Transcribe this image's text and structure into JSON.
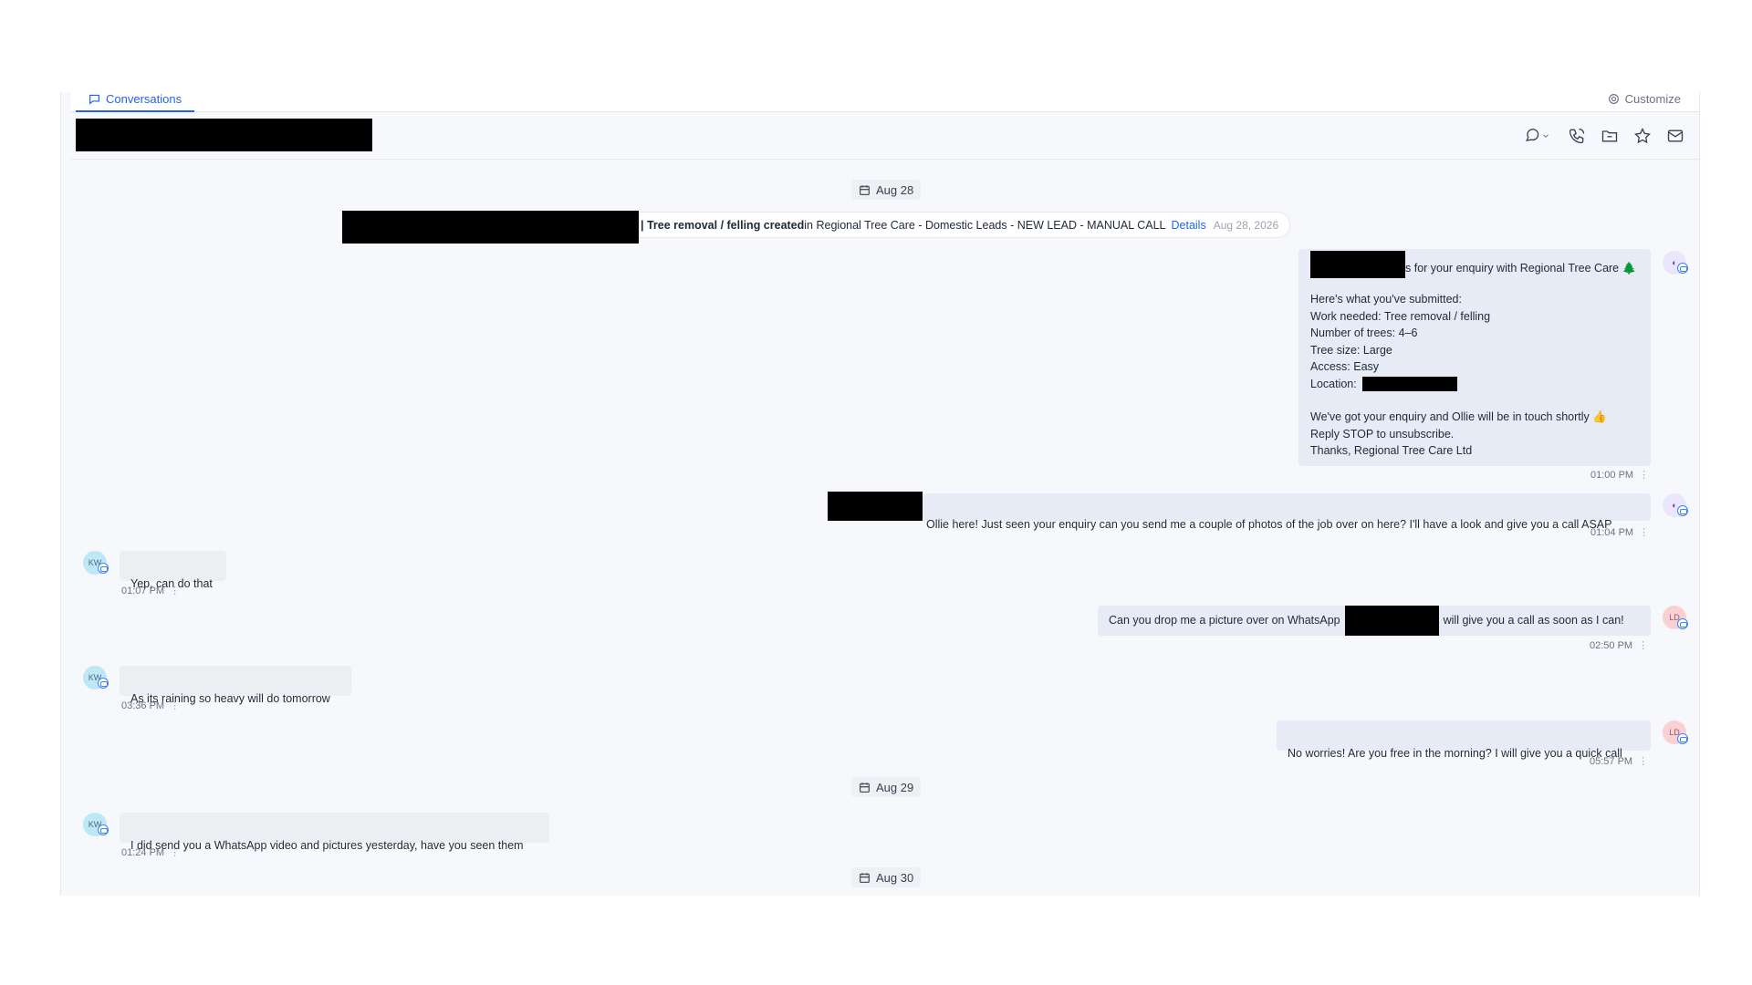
{
  "tabs": {
    "conversations": "Conversations",
    "customize": "Customize"
  },
  "header_icons": [
    "chat-channel-icon",
    "phone-icon",
    "folder-icon",
    "star-icon",
    "mail-icon"
  ],
  "dates": {
    "d1": "Aug 28",
    "d2": "Aug 29",
    "d3": "Aug 30"
  },
  "activity": {
    "bold": "| Tree removal / felling created",
    "rest": " in Regional Tree Care - Domestic Leads - NEW LEAD - MANUAL CALL",
    "link": "Details",
    "date": "Aug 28, 2026"
  },
  "messages": {
    "m1": {
      "line1": "s for your enquiry with Regional Tree Care 🌲",
      "body": "Here's what you've submitted:\nWork needed: Tree removal / felling\nNumber of trees: 4–6\nTree size: Large\nAccess: Easy",
      "location_label": "Location:",
      "tail": "We've got your enquiry and Ollie will be in touch shortly 👍\nReply STOP to unsubscribe.\nThanks, Regional Tree Care Ltd",
      "time": "01:00 PM"
    },
    "m2": {
      "text": "Ollie here! Just seen your enquiry can you send me a couple of photos of the job over on here? I'll have a look and give you a call ASAP",
      "time": "01:04 PM"
    },
    "m3": {
      "text": "Yep, can do that",
      "time": "01:07 PM",
      "avatar": "KW"
    },
    "m4": {
      "text_a": "Can you drop me a picture over on WhatsApp",
      "text_b": "will give you a call as soon as I can!",
      "time": "02:50 PM",
      "avatar": "LD"
    },
    "m5": {
      "text": "As its raining so heavy will do tomorrow",
      "time": "03:36 PM",
      "avatar": "KW"
    },
    "m6": {
      "text": "No worries! Are you free in the morning? I will give you a quick call",
      "time": "05:57 PM",
      "avatar": "LD"
    },
    "m7": {
      "text": "I did send you a WhatsApp video and pictures yesterday, have you seen them",
      "time": "01:24 PM",
      "avatar": "KW"
    }
  },
  "more_glyph": "⋮",
  "colors": {
    "accent": "#2563eb",
    "outgoing": "#e6ebf5",
    "incoming": "#eceef1"
  }
}
